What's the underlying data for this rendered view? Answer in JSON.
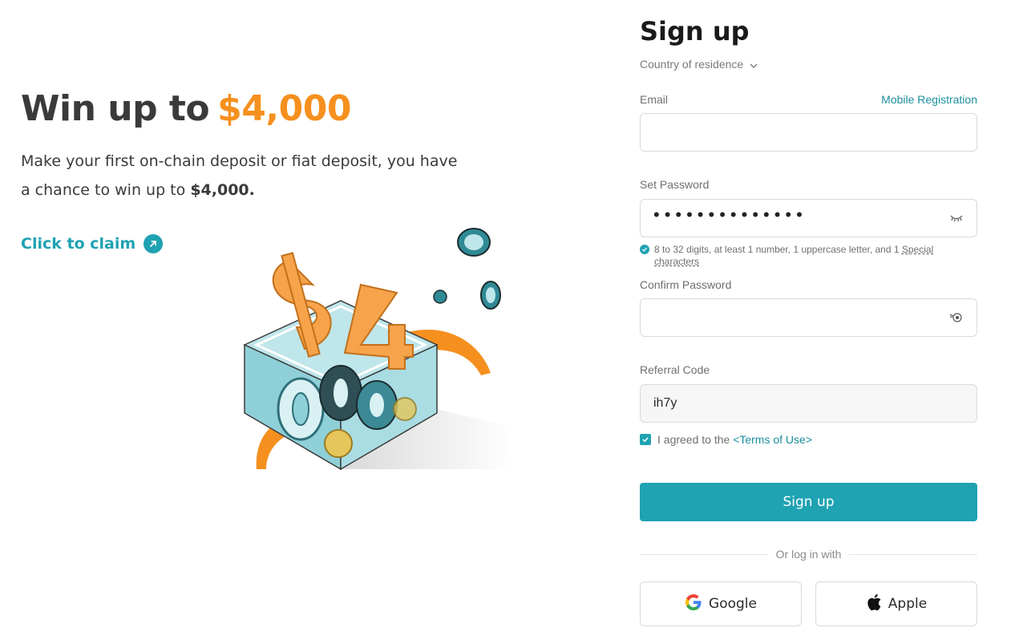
{
  "promo": {
    "title_prefix": "Win up to",
    "title_amount": "$4,000",
    "description": "Make your first on-chain deposit or fiat deposit,  you have a chance to win up to ",
    "description_amount": "$4,000.",
    "claim_label": "Click to claim"
  },
  "signup": {
    "title": "Sign up",
    "country_label": "Country of residence",
    "email_label": "Email",
    "mobile_registration_label": "Mobile Registration",
    "email_value": "",
    "password_label": "Set Password",
    "password_masked": "••••••••••••••",
    "password_hint": "8 to 32 digits, at least 1 number, 1 uppercase letter, and 1 ",
    "password_hint_special": "Special characters",
    "confirm_password_label": "Confirm Password",
    "confirm_password_value": "",
    "referral_label": "Referral Code",
    "referral_value": "ih7y",
    "agree_text": "I agreed to the ",
    "terms_label": "<Terms of Use>",
    "submit_label": "Sign up",
    "divider_label": "Or log in with",
    "google_label": "Google",
    "apple_label": "Apple"
  },
  "colors": {
    "accent": "#1fa2b2",
    "promo_amount": "#f5901e",
    "link": "#1b8fa0"
  },
  "icons": {
    "claim": "arrow-up-right-icon",
    "country": "chevron-down-icon",
    "password_toggle": "eye-closed-icon",
    "confirm_toggle": "eye-icon",
    "hint": "check-circle-icon",
    "agree": "checkbox-checked-icon",
    "google": "google-icon",
    "apple": "apple-icon"
  }
}
